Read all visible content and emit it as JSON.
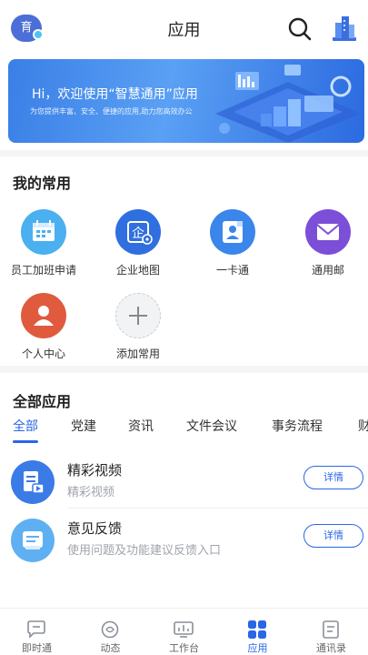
{
  "header": {
    "avatar_text": "育",
    "title": "应用",
    "search_icon": "search-icon",
    "right_icon": "building-icon"
  },
  "banner": {
    "title": "Hi，欢迎使用“智慧通用”应用",
    "subtitle": "为您提供丰富、安全、便捷的应用,助力您高效办公"
  },
  "favorites": {
    "title": "我的常用",
    "items": [
      {
        "label": "员工加班申请",
        "icon": "calendar-icon",
        "color": "#4ab0f0"
      },
      {
        "label": "企业地图",
        "icon": "enterprise-map-icon",
        "color": "#2f6fe0"
      },
      {
        "label": "一卡通",
        "icon": "card-icon",
        "color": "#3a86ea"
      },
      {
        "label": "通用邮",
        "icon": "mail-icon",
        "color": "#7b4fd8"
      },
      {
        "label": "个人中心",
        "icon": "person-icon",
        "color": "#e05b3e"
      },
      {
        "label": "添加常用",
        "icon": "plus-icon",
        "color": "#f2f3f5"
      }
    ]
  },
  "all_apps": {
    "title": "全部应用",
    "tabs": [
      "全部",
      "党建",
      "资讯",
      "文件会议",
      "事务流程",
      "财"
    ],
    "apps": [
      {
        "name": "精彩视频",
        "desc": "精彩视频",
        "button": "详情",
        "icon": "video-doc-icon",
        "color": "#3a7be6"
      },
      {
        "name": "意见反馈",
        "desc": "使用问题及功能建议反馈入口",
        "button": "详情",
        "icon": "feedback-icon",
        "color": "#5fb0f2"
      }
    ]
  },
  "bottom_nav": {
    "items": [
      {
        "label": "即时通",
        "icon": "chat-icon"
      },
      {
        "label": "动态",
        "icon": "refresh-circle-icon"
      },
      {
        "label": "工作台",
        "icon": "dashboard-icon"
      },
      {
        "label": "应用",
        "icon": "grid-icon",
        "active": true
      },
      {
        "label": "通讯录",
        "icon": "contacts-icon"
      }
    ],
    "accent": "#2a66e6"
  }
}
